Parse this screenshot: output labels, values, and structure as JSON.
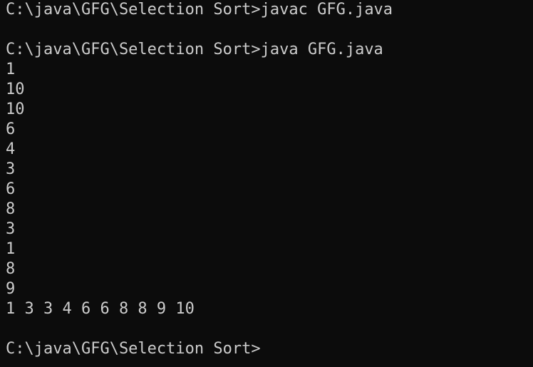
{
  "terminal": {
    "lines": [
      "C:\\java\\GFG\\Selection Sort>javac GFG.java",
      "",
      "C:\\java\\GFG\\Selection Sort>java GFG.java",
      "1",
      "10",
      "10",
      "6",
      "4",
      "3",
      "6",
      "8",
      "3",
      "1",
      "8",
      "9",
      "1 3 3 4 6 6 8 8 9 10",
      "",
      "C:\\java\\GFG\\Selection Sort>"
    ],
    "colors": {
      "background": "#0c0c0c",
      "foreground": "#cccccc"
    }
  }
}
